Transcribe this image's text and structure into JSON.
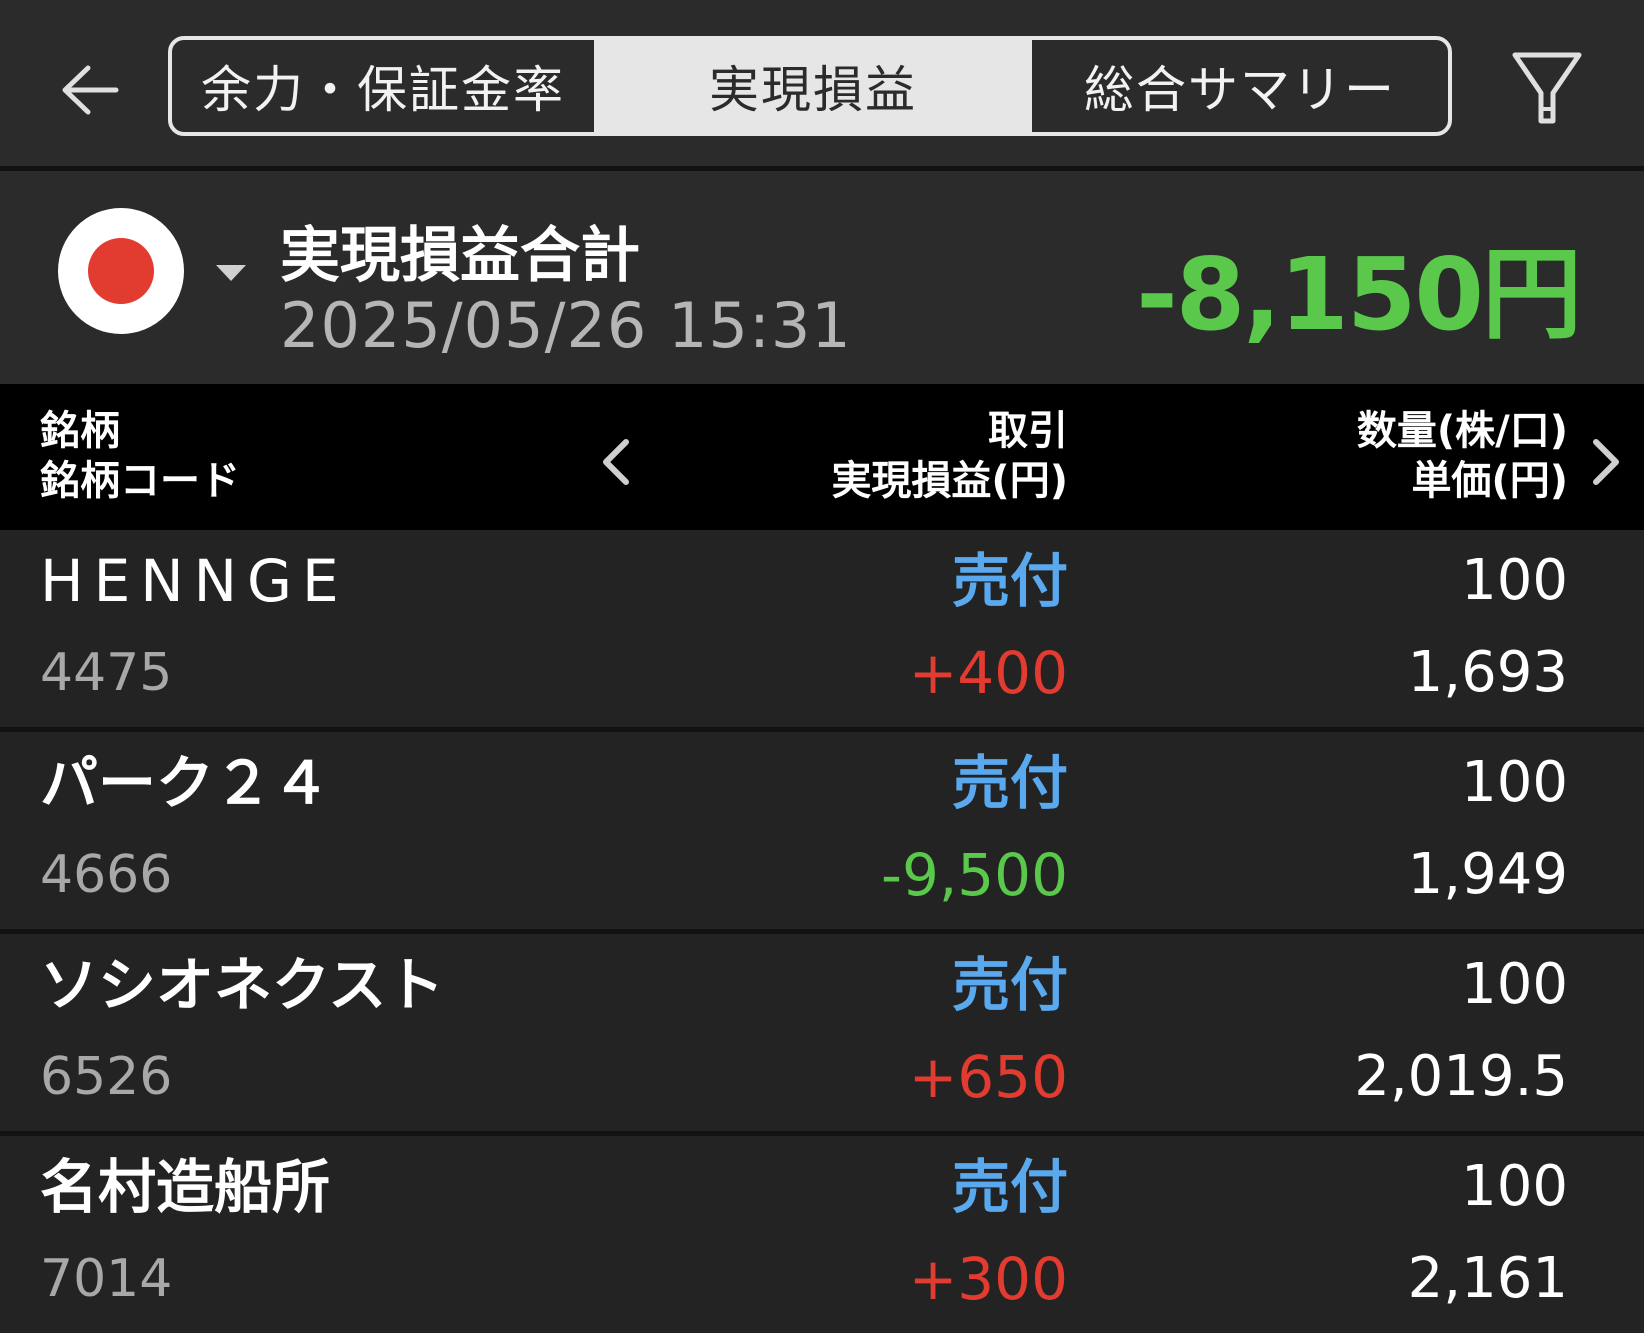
{
  "header": {
    "tabs": [
      {
        "label": "余力・保証金率"
      },
      {
        "label": "実現損益"
      },
      {
        "label": "総合サマリー"
      }
    ],
    "active_tab": 1,
    "back_icon": "arrow-left-icon",
    "filter_icon": "filter-icon"
  },
  "summary": {
    "title": "実現損益合計",
    "datetime": "2025/05/26  15:31",
    "total": "-8,150円",
    "total_color": "#5ac84b",
    "flag_icon": "japan-flag-icon"
  },
  "table": {
    "columns": {
      "left_line1": "銘柄",
      "left_line2": "銘柄コード",
      "mid_line1": "取引",
      "mid_line2": "実現損益(円)",
      "right_line1": "数量(株/口)",
      "right_line2": "単価(円)"
    },
    "rows": [
      {
        "name": "HENNGE",
        "code": "4475",
        "side": "売付",
        "pl": "+400",
        "qty": "100",
        "price": "1,693"
      },
      {
        "name": "パーク２４",
        "code": "4666",
        "side": "売付",
        "pl": "-9,500",
        "qty": "100",
        "price": "1,949"
      },
      {
        "name": "ソシオネクスト",
        "code": "6526",
        "side": "売付",
        "pl": "+650",
        "qty": "100",
        "price": "2,019.5"
      },
      {
        "name": "名村造船所",
        "code": "7014",
        "side": "売付",
        "pl": "+300",
        "qty": "100",
        "price": "2,161"
      }
    ]
  },
  "colors": {
    "positive": "#e23b30",
    "negative": "#5ac84b",
    "sell": "#5aa8ee"
  }
}
